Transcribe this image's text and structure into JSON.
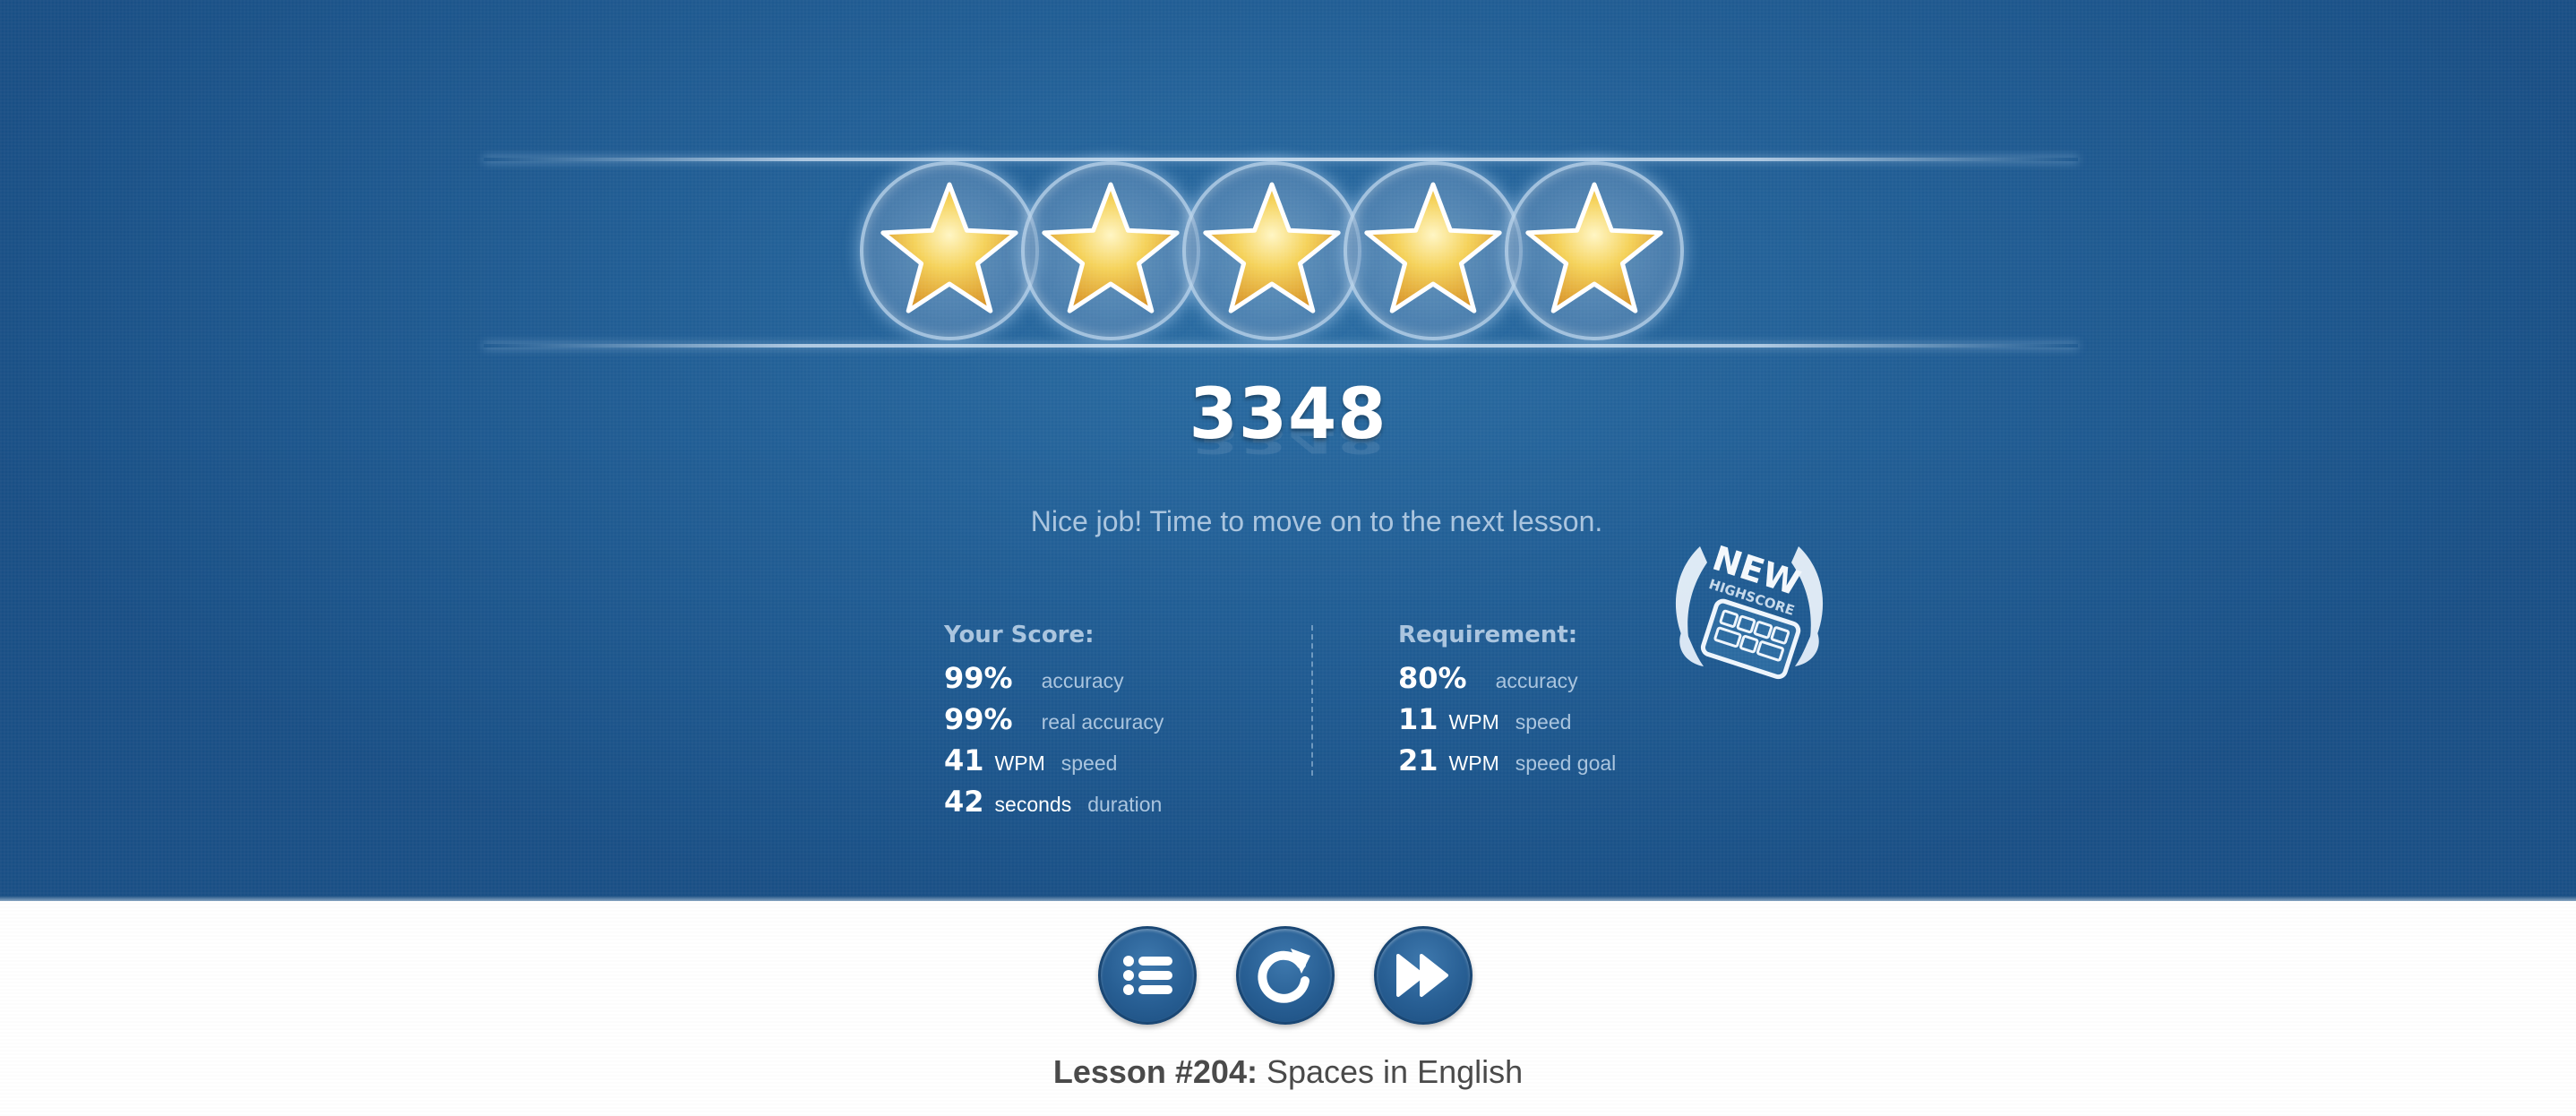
{
  "result": {
    "stars_earned": 5,
    "stars_total": 5,
    "score": "3348",
    "message": "Nice job! Time to move on to the next lesson."
  },
  "your_score": {
    "title": "Your Score:",
    "rows": [
      {
        "value": "99%",
        "unit": "",
        "label": "accuracy"
      },
      {
        "value": "99%",
        "unit": "",
        "label": "real accuracy"
      },
      {
        "value": "41",
        "unit": "WPM",
        "label": "speed"
      },
      {
        "value": "42",
        "unit": "seconds",
        "label": "duration"
      }
    ]
  },
  "requirement": {
    "title": "Requirement:",
    "rows": [
      {
        "value": "80%",
        "unit": "",
        "label": "accuracy"
      },
      {
        "value": "11",
        "unit": "WPM",
        "label": "speed"
      },
      {
        "value": "21",
        "unit": "WPM",
        "label": "speed goal"
      }
    ]
  },
  "highscore_badge": {
    "line1": "NEW",
    "line2": "HIGHSCORE"
  },
  "actions": {
    "menu_icon": "list-icon",
    "retry_icon": "retry-icon",
    "next_icon": "fast-forward-icon"
  },
  "lesson": {
    "prefix": "Lesson #204:",
    "name": " Spaces in English"
  },
  "colors": {
    "panel_blue": "#215e95",
    "star_gold": "#f3c845",
    "muted_text": "#a9c4de",
    "button_blue": "#285f94"
  }
}
